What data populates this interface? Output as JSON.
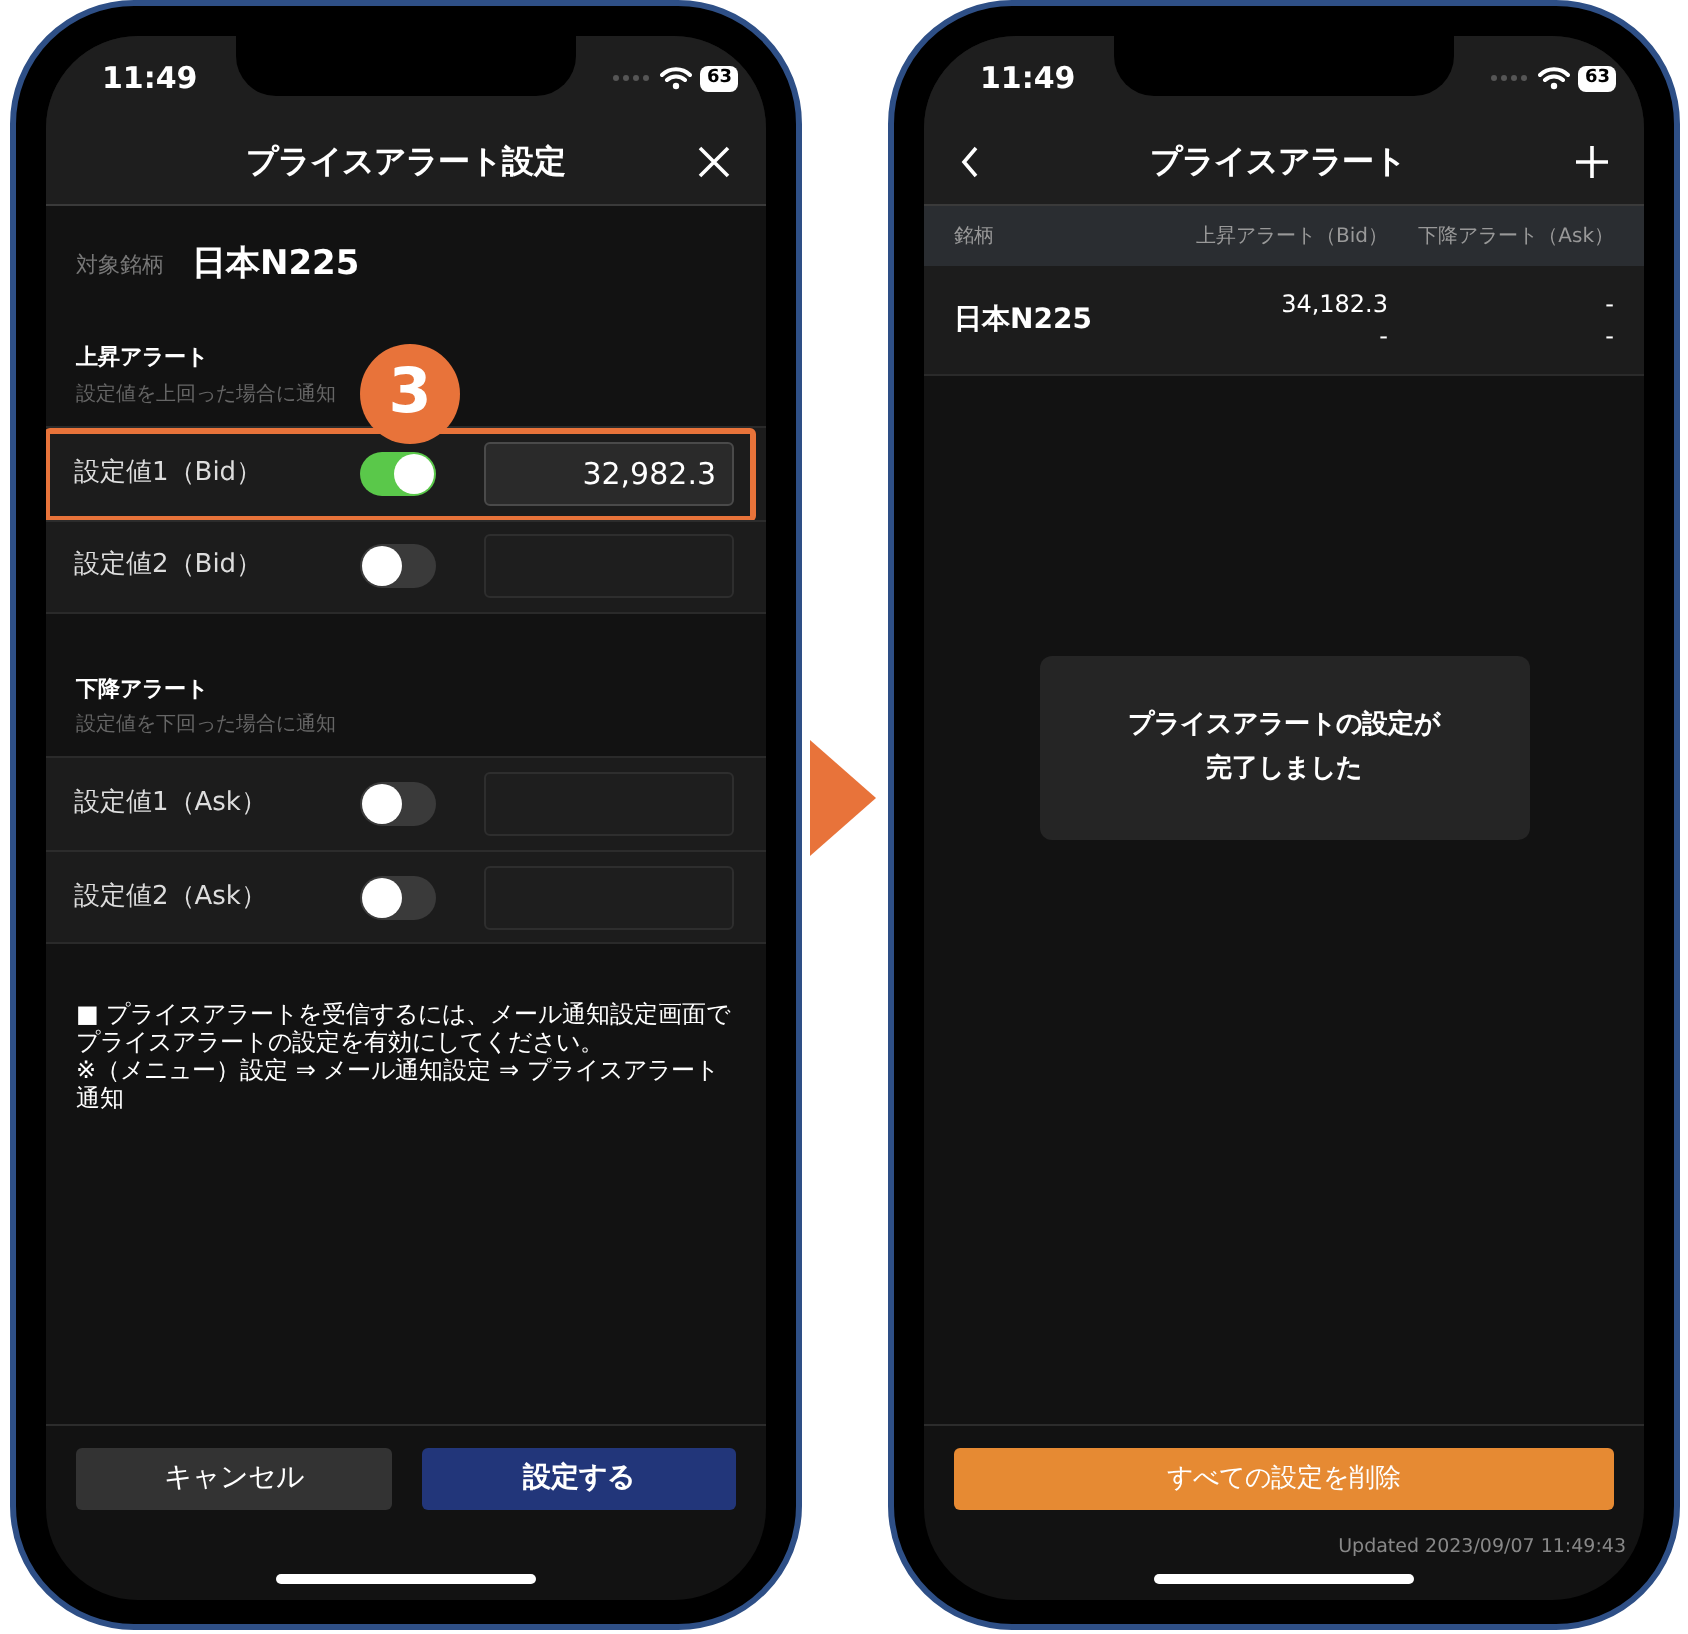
{
  "screens": [
    {
      "kind": "settings",
      "status": {
        "time": "11:49",
        "battery": "63"
      },
      "title": "プライスアラート設定",
      "symbol_label": "対象銘柄",
      "symbol": "日本N225",
      "step_badge": "3",
      "sections": [
        {
          "title": "上昇アラート",
          "subtitle": "設定値を上回った場合に通知",
          "rows": [
            {
              "label": "設定値1（Bid）",
              "on": true,
              "value": "32,982.3",
              "highlighted": true
            },
            {
              "label": "設定値2（Bid）",
              "on": false,
              "highlighted": false
            }
          ]
        },
        {
          "title": "下降アラート",
          "subtitle": "設定値を下回った場合に通知",
          "rows": [
            {
              "label": "設定値1（Ask）",
              "on": false,
              "highlighted": false
            },
            {
              "label": "設定値2（Ask）",
              "on": false,
              "highlighted": false
            }
          ]
        }
      ],
      "notes": [
        "■ プライスアラートを受信するには、メール通知設定画面でプライスアラートの設定を有効にしてください。",
        "※（メニュー）設定 ⇒ メール通知設定 ⇒ プライスアラート通知"
      ],
      "buttons": [
        {
          "label": "キャンセル",
          "kind": "secondary"
        },
        {
          "label": "設定する",
          "kind": "primary"
        }
      ]
    },
    {
      "kind": "list",
      "status": {
        "time": "11:49",
        "battery": "63"
      },
      "title": "プライスアラート",
      "table": {
        "columns": [
          "銘柄",
          "上昇アラート（Bid）",
          "下降アラート（Ask）"
        ],
        "rows": [
          {
            "name": "日本N225",
            "bid": [
              "34,182.3",
              "-"
            ],
            "ask": [
              "-",
              "-"
            ]
          }
        ]
      },
      "toast": [
        "プライスアラートの設定が",
        "完了しました"
      ],
      "delete_button": "すべての設定を削除",
      "updated": "Updated 2023/09/07 11:49:43"
    }
  ]
}
